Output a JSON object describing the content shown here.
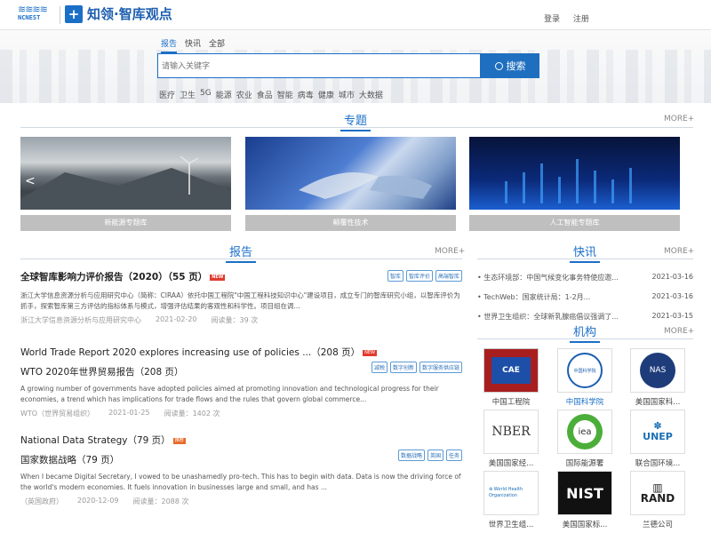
{
  "header": {
    "logo_text": "NCNEST",
    "brand_mark": "+",
    "brand_name": "知领·智库观点",
    "login": "登录",
    "register": "注册"
  },
  "search": {
    "tabs": [
      "报告",
      "快讯",
      "全部"
    ],
    "placeholder": "请输入关键字",
    "button": "搜索",
    "hot": [
      "医疗",
      "卫生",
      "5G",
      "能源",
      "农业",
      "食品",
      "智能",
      "病毒",
      "健康",
      "城市",
      "大数据"
    ]
  },
  "topics": {
    "title": "专题",
    "more": "MORE+",
    "prev": "<",
    "next": ">",
    "cards": [
      {
        "caption": "新能源专题库"
      },
      {
        "caption": "颠覆性技术"
      },
      {
        "caption": "人工智能专题库"
      }
    ]
  },
  "reports": {
    "title": "报告",
    "more": "MORE+",
    "new_badge": "NEW",
    "items": [
      {
        "title": "全球智库影响力评价报告（2020）（55 页）",
        "tags": [
          "智库",
          "智库评价",
          "高端智库"
        ],
        "desc": "浙江大学信息资源分析与应用研究中心（简称：CIRAA）依托中国工程院\"中国工程科技知识中心\"建设项目，成立专门的智库研究小组，以智库评价为抓手，探索智库第三方评估的指标体系与模式，增强评估结果的客观性和科学性。项目组在调...",
        "source": "浙江大学信息资源分析与应用研究中心",
        "date": "2021-02-20",
        "reads": "阅读量：39 次"
      },
      {
        "title": "World Trade Report 2020 explores increasing use of policies ...（208 页）",
        "subtitle": "WTO 2020年世界贸易报告（208 页）",
        "tags": [
          "减税",
          "数字创新",
          "数字服务供应链"
        ],
        "desc": "A growing number of governments have adopted policies aimed at promoting innovation and technological progress for their economies, a trend which has implications for trade flows and the rules that govern global commerce...",
        "source": "WTO（世界贸易组织）",
        "date": "2021-01-25",
        "reads": "阅读量：1402 次"
      },
      {
        "title": "National Data Strategy（79 页）",
        "badge": "推荐",
        "subtitle": "国家数据战略（79 页）",
        "tags": [
          "数据战略",
          "英国",
          "任务"
        ],
        "desc": "When I became Digital Secretary, I vowed to be unashamedly pro-tech. This has to begin with data. Data is now the driving force of the world's modern economies. It fuels innovation in businesses large and small, and has ...",
        "source": "（英国政府）",
        "date": "2020-12-09",
        "reads": "阅读量：2088 次"
      }
    ]
  },
  "news": {
    "title": "快讯",
    "more": "MORE+",
    "items": [
      {
        "text": "• 生态环境部：中国气候变化事务特使应邀...",
        "date": "2021-03-16"
      },
      {
        "text": "• TechWeb：国家统计局：1-2月...",
        "date": "2021-03-16"
      },
      {
        "text": "• 世界卫生组织：全球新乳腺癌倡议强调了...",
        "date": "2021-03-15"
      }
    ]
  },
  "orgs": {
    "title": "机构",
    "more": "MORE+",
    "items": [
      {
        "name": "中国工程院",
        "logo": "CAE"
      },
      {
        "name": "中国科学院",
        "logo": "中国科学院"
      },
      {
        "name": "美国国家科...",
        "logo": "NAS"
      },
      {
        "name": "美国国家经...",
        "logo": "NBER"
      },
      {
        "name": "国际能源署",
        "logo": "iea"
      },
      {
        "name": "联合国环境...",
        "logo": "UNEP"
      },
      {
        "name": "世界卫生组...",
        "logo": "World Health Organization"
      },
      {
        "name": "美国国家标...",
        "logo": "NIST"
      },
      {
        "name": "兰德公司",
        "logo": "RAND"
      }
    ]
  },
  "colors": {
    "accent": "#1b6fc7",
    "new_badge": "#e23a2e"
  }
}
